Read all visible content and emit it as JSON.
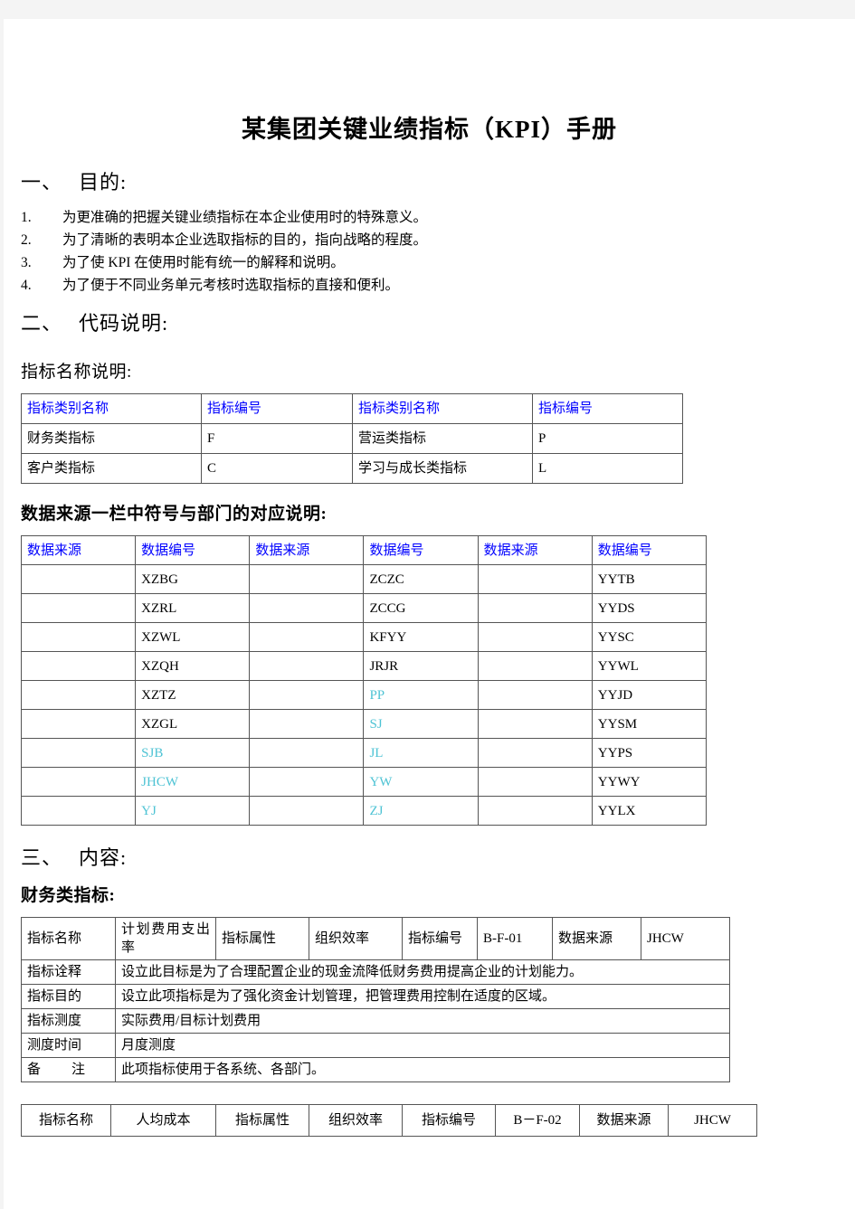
{
  "document": {
    "title": "某集团关键业绩指标（KPI）手册"
  },
  "section_purpose": {
    "num": "一、",
    "heading": "目的:",
    "items": [
      {
        "idx": "1.",
        "text": "为更准确的把握关键业绩指标在本企业使用时的特殊意义。"
      },
      {
        "idx": "2.",
        "text": "为了清晰的表明本企业选取指标的目的，指向战略的程度。"
      },
      {
        "idx": "3.",
        "text": "为了使 KPI 在使用时能有统一的解释和说明。"
      },
      {
        "idx": "4.",
        "text": "为了便于不同业务单元考核时选取指标的直接和便利。"
      }
    ]
  },
  "section_codes": {
    "num": "二、",
    "heading": "代码说明:",
    "sub_heading_1": "指标名称说明:",
    "table_name_codes": {
      "headers": [
        "指标类别名称",
        "指标编号",
        "指标类别名称",
        "指标编号"
      ],
      "rows": [
        [
          "财务类指标",
          "F",
          "营运类指标",
          "P"
        ],
        [
          "客户类指标",
          "C",
          "学习与成长类指标",
          "L"
        ]
      ]
    },
    "sub_heading_2": "数据来源一栏中符号与部门的对应说明:",
    "table_data_sources": {
      "headers": [
        "数据来源",
        "数据编号",
        "数据来源",
        "数据编号",
        "数据来源",
        "数据编号"
      ],
      "rows": [
        [
          "",
          "XZBG",
          "",
          "ZCZC",
          "",
          "YYTB"
        ],
        [
          "",
          "XZRL",
          "",
          "ZCCG",
          "",
          "YYDS"
        ],
        [
          "",
          "XZWL",
          "",
          "KFYY",
          "",
          "YYSC"
        ],
        [
          "",
          "XZQH",
          "",
          "JRJR",
          "",
          "YYWL"
        ],
        [
          "",
          "XZTZ",
          "",
          "PP",
          "",
          "YYJD"
        ],
        [
          "",
          "XZGL",
          "",
          "SJ",
          "",
          "YYSM"
        ],
        [
          "",
          "SJB",
          "",
          "JL",
          "",
          "YYPS"
        ],
        [
          "",
          "JHCW",
          "",
          "YW",
          "",
          "YYWY"
        ],
        [
          "",
          "YJ",
          "",
          "ZJ",
          "",
          "YYLX"
        ]
      ],
      "cyan_cells": [
        "4-3",
        "5-3",
        "6-1",
        "6-3",
        "7-1",
        "7-3",
        "8-1",
        "8-3"
      ]
    }
  },
  "section_content": {
    "num": "三、",
    "heading": "内容:",
    "sub_heading": "财务类指标:",
    "kpi_01": {
      "label_name": "指标名称",
      "value_name": "计划费用支出率",
      "label_attr": "指标属性",
      "value_attr": "组织效率",
      "label_code": "指标编号",
      "value_code": "B-F-01",
      "label_source": "数据来源",
      "value_source": "JHCW",
      "rows": [
        {
          "label": "指标诠释",
          "value": "设立此目标是为了合理配置企业的现金流降低财务费用提高企业的计划能力。"
        },
        {
          "label": "指标目的",
          "value": "设立此项指标是为了强化资金计划管理，把管理费用控制在适度的区域。"
        },
        {
          "label": "指标测度",
          "value": "实际费用/目标计划费用"
        },
        {
          "label": "测度时间",
          "value": "月度测度"
        },
        {
          "label": "备  注",
          "value": "此项指标使用于各系统、各部门。"
        }
      ]
    },
    "kpi_02": {
      "label_name": "指标名称",
      "value_name": "人均成本",
      "label_attr": "指标属性",
      "value_attr": "组织效率",
      "label_code": "指标编号",
      "value_code": "B－F-02",
      "label_source": "数据来源",
      "value_source": "JHCW"
    }
  },
  "colors": {
    "header_blue": "#0000ff",
    "accent_cyan": "#4ec3d4",
    "table_border": "#555555",
    "page_background": "#ffffff",
    "canvas_background": "#f4f4f4"
  }
}
